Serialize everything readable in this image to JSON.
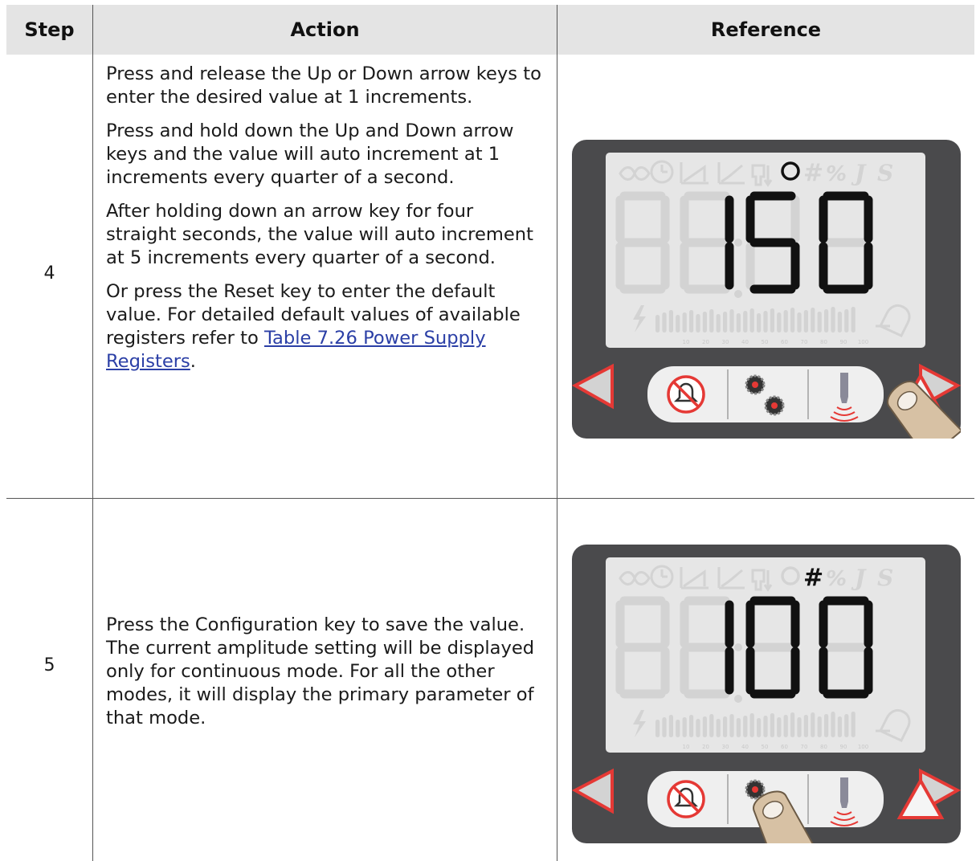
{
  "table": {
    "headers": {
      "step": "Step",
      "action": "Action",
      "reference": "Reference"
    },
    "rows": [
      {
        "step": "4",
        "paragraphs": [
          "Press and release the Up or Down arrow keys to enter the desired value at 1 increments.",
          "Press and hold down the Up and Down arrow keys and the value will auto increment at 1 increments every quarter of a second.",
          "After holding down an arrow key for four straight seconds, the value will auto increment at 5 increments every quarter of a second."
        ],
        "last_paragraph_text": "Or press the Reset key to enter the default value. For detailed default values of available registers refer to",
        "link_text": "Table 7.26 Power Supply Registers",
        "trailing": ".",
        "display": {
          "digits": "150",
          "mode_indicator": "O"
        }
      },
      {
        "step": "5",
        "paragraph": "Press the Configuration key to save the value. The current amplitude setting will be displayed only for continuous mode. For all the other modes, it will display the primary parameter of that mode.",
        "display": {
          "digits": "100",
          "mode_indicator": "#"
        }
      }
    ]
  },
  "display_scale_labels": [
    "10",
    "20",
    "30",
    "40",
    "50",
    "60",
    "70",
    "80",
    "90",
    "100"
  ],
  "icons": {
    "lcd_status": [
      "infinity-icon",
      "clock-icon",
      "energy-icon",
      "ramp-icon",
      "distance-icon",
      "circle-icon",
      "hash-icon",
      "percent-icon",
      "joule-icon",
      "seconds-icon"
    ],
    "buttons": [
      "down-arrow-icon",
      "alarm-reset-icon",
      "configuration-icon",
      "horn-test-icon",
      "up-arrow-icon",
      "finger-press-icon"
    ]
  },
  "colors": {
    "panel": "#4a4a4c",
    "lcd": "#e6e6e6",
    "segment_on": "#111111",
    "segment_off": "#d3d3d3",
    "arrow": "#e53935",
    "link": "#2b3fa6",
    "header_bg": "#e4e4e4"
  }
}
